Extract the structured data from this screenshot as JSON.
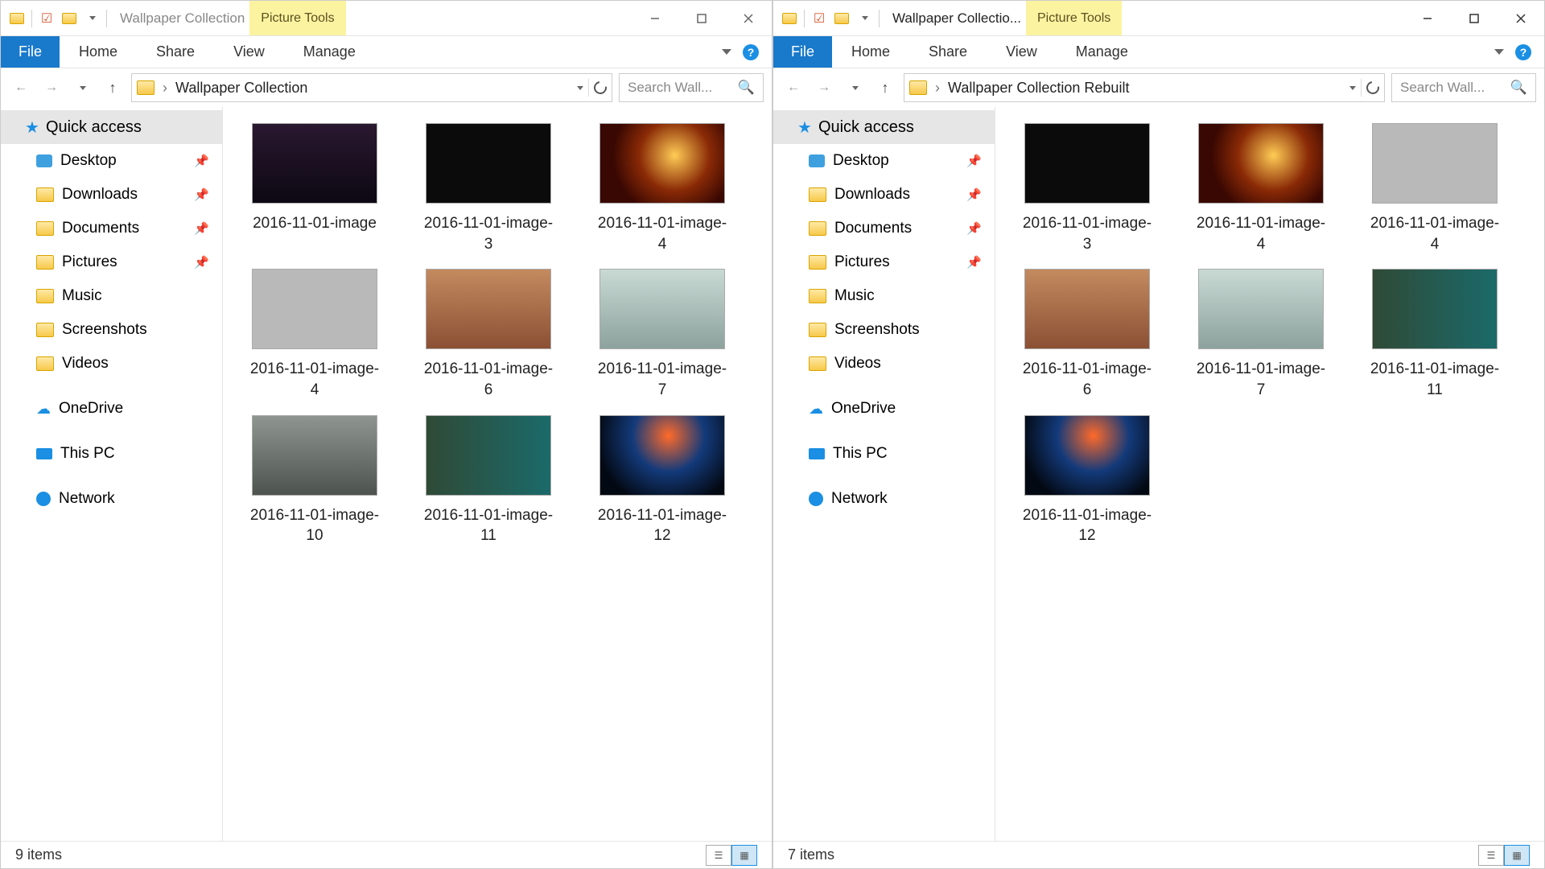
{
  "left": {
    "title": "Wallpaper Collection",
    "contextual_tab": "Picture Tools",
    "tabs": {
      "file": "File",
      "home": "Home",
      "share": "Share",
      "view": "View",
      "manage": "Manage"
    },
    "breadcrumb": "Wallpaper Collection",
    "search_placeholder": "Search Wall...",
    "nav": {
      "quick": "Quick access",
      "items": [
        "Desktop",
        "Downloads",
        "Documents",
        "Pictures",
        "Music",
        "Screenshots",
        "Videos"
      ],
      "pinned": [
        true,
        true,
        true,
        true,
        false,
        false,
        false
      ],
      "onedrive": "OneDrive",
      "thispc": "This PC",
      "network": "Network"
    },
    "files": [
      {
        "name": "2016-11-01-image",
        "thumb": "t-forest"
      },
      {
        "name": "2016-11-01-image-3",
        "thumb": "t-abstract"
      },
      {
        "name": "2016-11-01-image-4",
        "thumb": "t-rocket"
      },
      {
        "name": "2016-11-01-image-4",
        "thumb": "t-gameboy"
      },
      {
        "name": "2016-11-01-image-6",
        "thumb": "t-car"
      },
      {
        "name": "2016-11-01-image-7",
        "thumb": "t-atat"
      },
      {
        "name": "2016-11-01-image-10",
        "thumb": "t-house"
      },
      {
        "name": "2016-11-01-image-11",
        "thumb": "t-elves"
      },
      {
        "name": "2016-11-01-image-12",
        "thumb": "t-galaxy"
      }
    ],
    "status": "9 items"
  },
  "right": {
    "title": "Wallpaper Collectio...",
    "contextual_tab": "Picture Tools",
    "tabs": {
      "file": "File",
      "home": "Home",
      "share": "Share",
      "view": "View",
      "manage": "Manage"
    },
    "breadcrumb": "Wallpaper Collection Rebuilt",
    "search_placeholder": "Search Wall...",
    "nav": {
      "quick": "Quick access",
      "items": [
        "Desktop",
        "Downloads",
        "Documents",
        "Pictures",
        "Music",
        "Screenshots",
        "Videos"
      ],
      "pinned": [
        true,
        true,
        true,
        true,
        false,
        false,
        false
      ],
      "onedrive": "OneDrive",
      "thispc": "This PC",
      "network": "Network"
    },
    "files": [
      {
        "name": "2016-11-01-image-3",
        "thumb": "t-abstract"
      },
      {
        "name": "2016-11-01-image-4",
        "thumb": "t-rocket"
      },
      {
        "name": "2016-11-01-image-4",
        "thumb": "t-gameboy"
      },
      {
        "name": "2016-11-01-image-6",
        "thumb": "t-car"
      },
      {
        "name": "2016-11-01-image-7",
        "thumb": "t-atat"
      },
      {
        "name": "2016-11-01-image-11",
        "thumb": "t-elves"
      },
      {
        "name": "2016-11-01-image-12",
        "thumb": "t-galaxy"
      }
    ],
    "status": "7 items"
  }
}
